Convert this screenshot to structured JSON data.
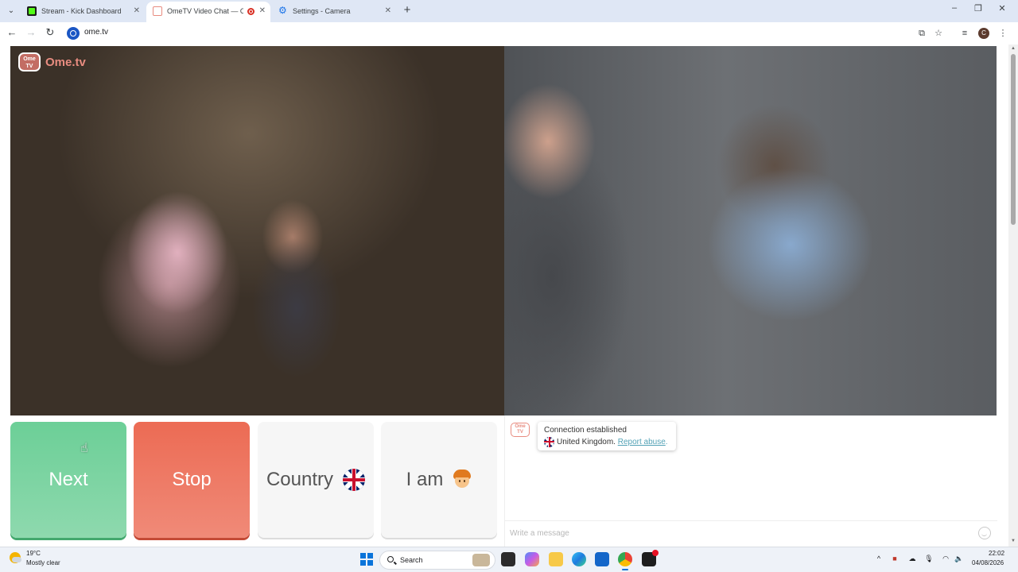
{
  "browser": {
    "tabs": [
      {
        "title": "Stream - Kick Dashboard",
        "active": false,
        "favicon": "kick-icon",
        "color": "#53fc18"
      },
      {
        "title": "OmeTV Video Chat — Ome",
        "active": true,
        "favicon": "ometv-icon",
        "color": "#e88c80",
        "recording": true
      },
      {
        "title": "Settings - Camera",
        "active": false,
        "favicon": "settings-gear-icon",
        "color": "#1a73e8"
      }
    ],
    "address": "ome.tv",
    "new_tab_icon": "+",
    "profile_initial": "C"
  },
  "page": {
    "logo_text": "Ome.tv",
    "logo_badge": "Ome TV",
    "buttons": {
      "next": "Next",
      "stop": "Stop",
      "country": "Country",
      "iam": "I am"
    },
    "colors": {
      "next": "#6ccf97",
      "stop": "#ec6b54",
      "link": "#53a2b6"
    },
    "chat": {
      "status": "Connection established",
      "country": "United Kingdom.",
      "report_link": "Report abuse",
      "report_suffix": ".",
      "input_placeholder": "Write a message"
    }
  },
  "taskbar": {
    "weather_temp": "19°C",
    "weather_cond": "Mostly clear",
    "search_label": "Search",
    "time": "22:02",
    "date": "04/08/2026",
    "apps": [
      "file-explorer-icon",
      "copilot-icon",
      "folder-icon",
      "edge-icon",
      "store-icon",
      "chrome-icon",
      "capcut-icon"
    ]
  }
}
